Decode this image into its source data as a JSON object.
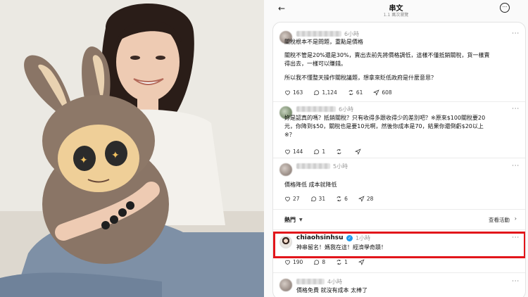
{
  "header": {
    "back_icon": "arrow-left-icon",
    "title": "串文",
    "views": "1.1 萬次瀏覽",
    "more_icon": "more-horizontal-icon"
  },
  "posts": [
    {
      "time": "6小時",
      "paragraphs": [
        "關稅根本不是問題，重點是價格",
        "關稅不管是20%還是30%，賣出去前先將價格調低，這樣不僅抵銷關稅，貨一樣賣",
        "得出去，一樣可以賺錢。",
        "所以我不懂整天操作關稅議題，想拿來貶低政府是什麼意思？"
      ],
      "likes": "163",
      "comments": "1,124",
      "reposts": "61",
      "shares": "608"
    },
    {
      "time": "6小時",
      "lines": [
        "妳是認真的嗎？抵銷關稅？只有收得多跟收得少的差別吧？※原來$100關稅要20",
        "元，你降到$50，關稅也是要10元啊，然後你成本是70，結果你還倒虧$20以上",
        "※？"
      ],
      "likes": "144",
      "comments": "1"
    },
    {
      "time": "5小時",
      "text": "價格降低 成本就降低",
      "likes": "27",
      "comments": "31",
      "reposts": "6",
      "shares": "28"
    }
  ],
  "sort_bar": {
    "hot_label": "熱門",
    "activity_label": "查看活動"
  },
  "highlighted_reply": {
    "username": "chiaohsinhsu",
    "time": "1小時",
    "text": "神串留名！媽我在這！經濟學奇蹟！",
    "likes": "190",
    "comments": "8",
    "reposts": "1"
  },
  "last_reply": {
    "time": "4小時",
    "text": "價格免費 就沒有成本 太棒了"
  },
  "colors": {
    "highlight_border": "#e2151b",
    "verified_badge": "#1d9bf0"
  }
}
